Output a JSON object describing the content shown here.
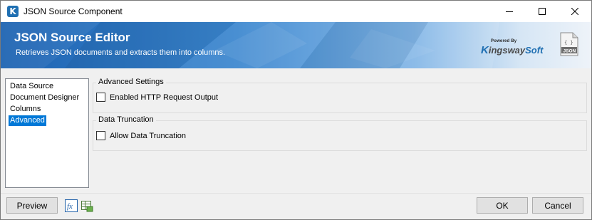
{
  "window": {
    "title": "JSON Source Component",
    "app_icon_letter": "K"
  },
  "banner": {
    "title": "JSON Source Editor",
    "subtitle": "Retrieves JSON documents and extracts them into columns.",
    "brand_powered_by": "Powered By",
    "brand_k": "K",
    "brand_ingsway": "ingsway",
    "brand_soft": "Soft",
    "doc_icon_braces": "{ }",
    "doc_icon_label": "JSON"
  },
  "nav": {
    "items": [
      {
        "label": "Data Source"
      },
      {
        "label": "Document Designer"
      },
      {
        "label": "Columns"
      },
      {
        "label": "Advanced",
        "selected": true
      }
    ]
  },
  "advanced_settings": {
    "title": "Advanced Settings",
    "enabled_http_label": "Enabled HTTP Request Output",
    "enabled_http_checked": false
  },
  "data_truncation": {
    "title": "Data Truncation",
    "allow_label": "Allow Data Truncation",
    "allow_checked": false
  },
  "footer": {
    "preview_label": "Preview",
    "ok_label": "OK",
    "cancel_label": "Cancel"
  },
  "colors": {
    "selection": "#0078d7",
    "brand_blue": "#1f6fb2"
  }
}
